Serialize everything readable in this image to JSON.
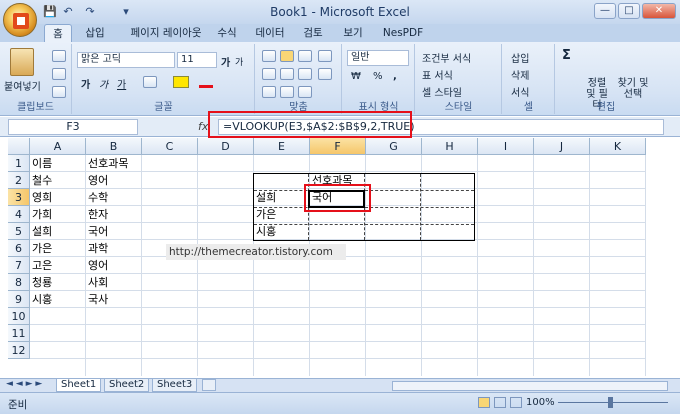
{
  "titlebar": {
    "title": "Book1 - Microsoft Excel",
    "qat_save": "💾",
    "qat_undo": "↶",
    "qat_redo": "↷",
    "qat_customize": "▾"
  },
  "window_buttons": {
    "minimize": "—",
    "maximize": "□",
    "close": "✕"
  },
  "tabs": [
    "홈",
    "삽입",
    "페이지 레이아웃",
    "수식",
    "데이터",
    "검토",
    "보기",
    "NesPDF"
  ],
  "ribbon": {
    "clipboard": {
      "paste_label": "붙여넣기",
      "group_label": "클립보드"
    },
    "font": {
      "font_name": "맑은 고딕",
      "font_size": "11",
      "bold": "가",
      "italic": "가",
      "underline": "가",
      "grow": "가",
      "shrink": "가",
      "group_label": "글꼴"
    },
    "alignment": {
      "group_label": "맞춤"
    },
    "number": {
      "format": "일반",
      "currency": "₩",
      "percent": "%",
      "comma": ",",
      "group_label": "표시 형식"
    },
    "styles": {
      "conditional": "조건부 서식",
      "table": "표 서식",
      "cell_style": "셀 스타일",
      "group_label": "스타일"
    },
    "cells": {
      "insert": "삽입",
      "delete": "삭제",
      "format": "서식",
      "group_label": "셀"
    },
    "editing": {
      "sum": "Σ",
      "sort": "정렬 및 필터",
      "find": "찾기 및 선택",
      "group_label": "편집"
    }
  },
  "formula_bar": {
    "name_box": "F3",
    "fx": "fx",
    "formula": "=VLOOKUP(E3,$A$2:$B$9,2,TRUE)"
  },
  "columns": [
    "A",
    "B",
    "C",
    "D",
    "E",
    "F",
    "G",
    "H",
    "I",
    "J",
    "K"
  ],
  "rows": [
    "1",
    "2",
    "3",
    "4",
    "5",
    "6",
    "7",
    "8",
    "9",
    "10",
    "11",
    "12"
  ],
  "cells": {
    "A": [
      "이름",
      "철수",
      "영희",
      "가희",
      "설희",
      "가은",
      "고은",
      "청룡",
      "시홍"
    ],
    "B": [
      "선호과목",
      "영어",
      "수학",
      "한자",
      "국어",
      "과학",
      "영어",
      "사회",
      "국사"
    ],
    "E": [
      "설희",
      "가은",
      "시홍"
    ],
    "F2": "선호과목",
    "F3": "국어"
  },
  "watermark": "http://themecreator.tistory.com",
  "sheets": [
    "Sheet1",
    "Sheet2",
    "Sheet3"
  ],
  "status": {
    "ready": "준비",
    "zoom": "100%"
  }
}
